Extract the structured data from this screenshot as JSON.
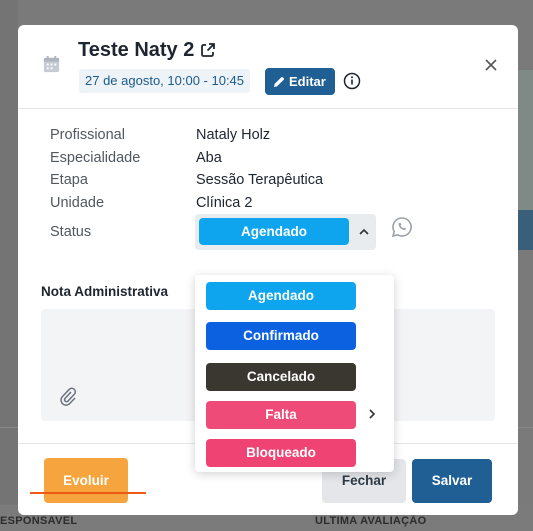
{
  "background": {
    "columns": [
      "ESPONSAVEL",
      "ULTIMA AVALIAÇÃO"
    ]
  },
  "modal": {
    "title": "Teste Naty 2",
    "date": "27 de agosto, 10:00 - 10:45",
    "edit_label": "Editar",
    "fields": [
      {
        "label": "Profissional",
        "value": "Nataly Holz"
      },
      {
        "label": "Especialidade",
        "value": "Aba"
      },
      {
        "label": "Etapa",
        "value": "Sessão Terapêutica"
      },
      {
        "label": "Unidade",
        "value": "Clínica 2"
      }
    ],
    "status": {
      "label": "Status",
      "selected": "Agendado",
      "options": [
        {
          "label": "Agendado",
          "color": "#0ea5ee"
        },
        {
          "label": "Confirmado",
          "color": "#0b61e0"
        },
        {
          "label": "Cancelado",
          "color": "#3a3630"
        },
        {
          "label": "Falta",
          "color": "#ef4b78"
        },
        {
          "label": "Bloqueado",
          "color": "#ef4373"
        }
      ]
    },
    "nota_label": "Nota Administrativa",
    "footer": {
      "evoluir": "Evoluir",
      "fechar": "Fechar",
      "salvar": "Salvar"
    }
  },
  "colors": {
    "primary": "#1f5f93",
    "accent_orange": "#f6a43e",
    "status_selected": "#0ea5ee"
  }
}
